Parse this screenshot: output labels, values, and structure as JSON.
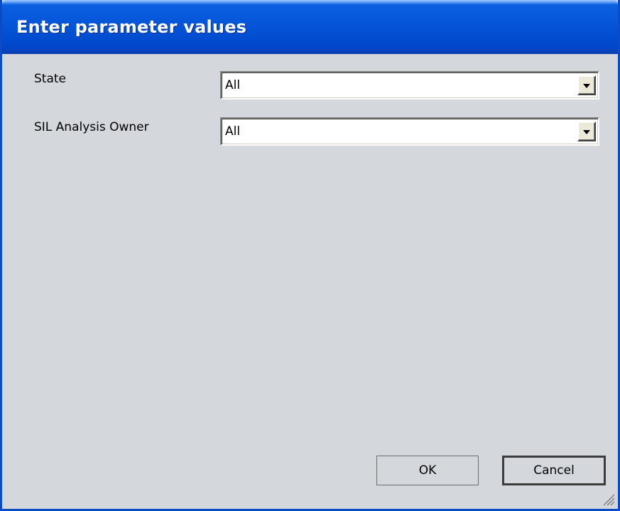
{
  "dialog": {
    "title": "Enter parameter values"
  },
  "parameters": [
    {
      "label": "State",
      "value": "All"
    },
    {
      "label": "SIL Analysis Owner",
      "value": "All"
    }
  ],
  "buttons": {
    "ok_label": "OK",
    "cancel_label": "Cancel"
  },
  "icons": {
    "dropdown": "chevron-down-icon",
    "resize": "resize-grip-icon"
  },
  "colors": {
    "titlebar": "#0553d6",
    "window_border": "#0a4bc8",
    "dialog_background": "#d4d8dd"
  }
}
